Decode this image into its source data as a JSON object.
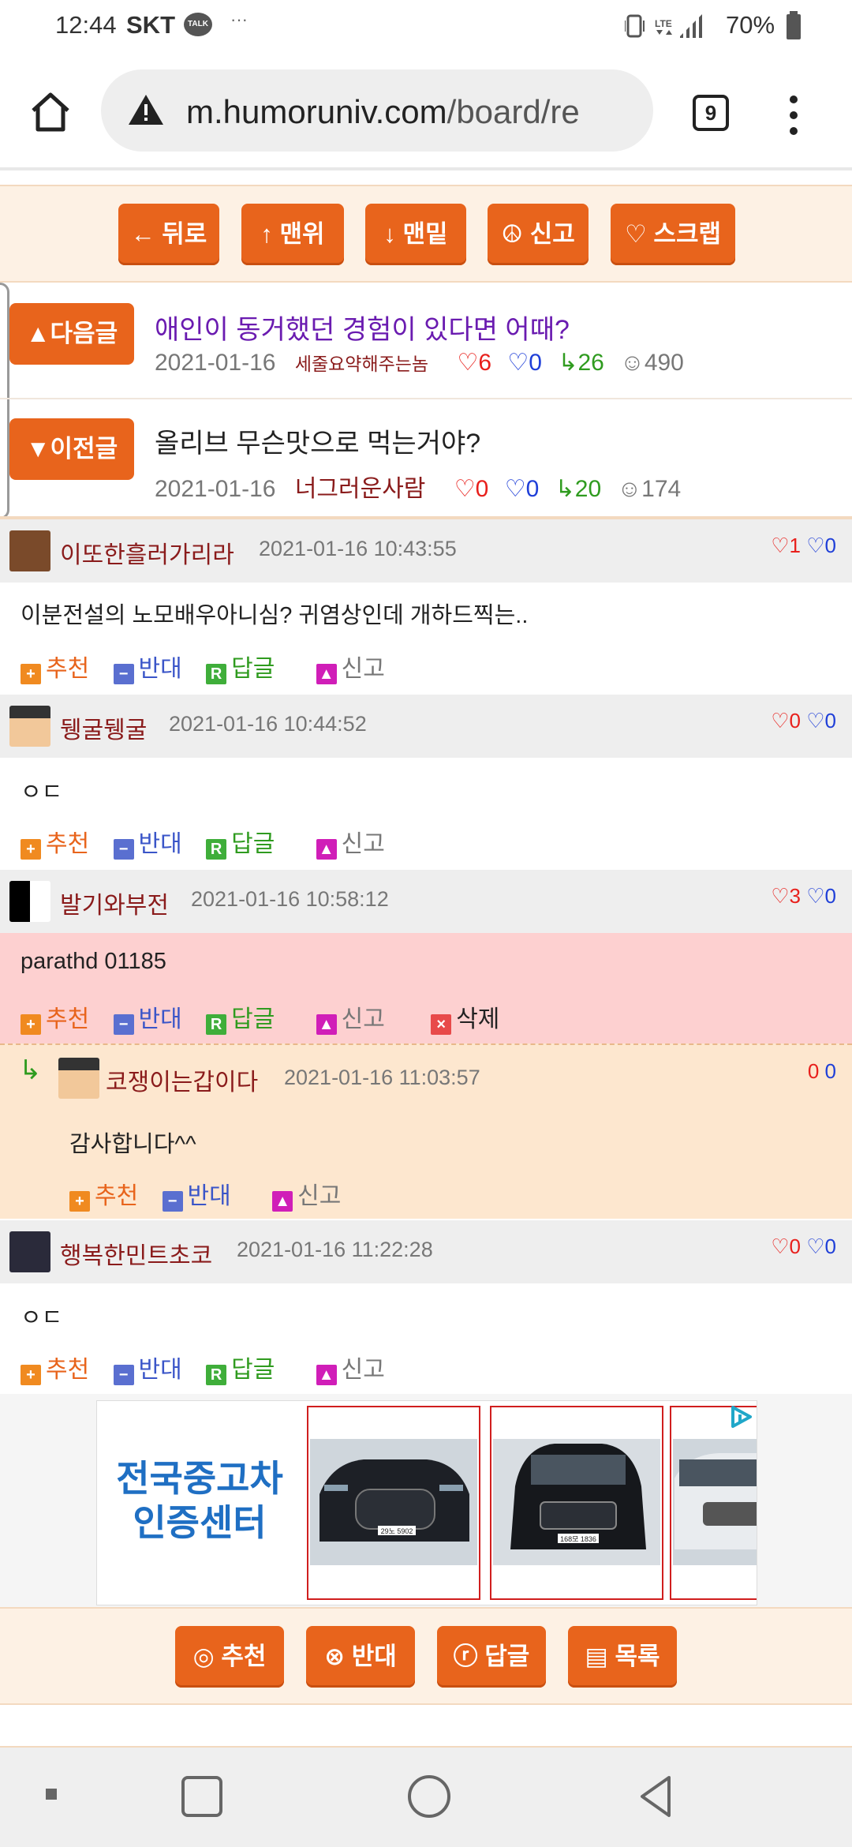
{
  "status_bar": {
    "time": "12:44",
    "carrier": "SKT",
    "talk_badge": "TALK",
    "overflow": "···",
    "battery": "70%"
  },
  "browser": {
    "url_host": "m.humoruniv.com",
    "url_path": "/board/re",
    "tab_count": "9"
  },
  "nav_buttons": [
    {
      "label": "← 뒤로"
    },
    {
      "label": "↑ 맨위"
    },
    {
      "label": "↓ 맨밑"
    },
    {
      "label": "신고"
    },
    {
      "label": "스크랩"
    }
  ],
  "next_post": {
    "button": "▲다음글",
    "title": "애인이 동거했던 경험이 있다면 어때?",
    "date": "2021-01-16",
    "author": "세줄요약해주는놈",
    "up": "6",
    "down": "0",
    "replies": "26",
    "views": "490"
  },
  "prev_post": {
    "button": "▼이전글",
    "title": "올리브 무슨맛으로 먹는거야?",
    "date": "2021-01-16",
    "author": "너그러운사람",
    "up": "0",
    "down": "0",
    "replies": "20",
    "views": "174"
  },
  "actions": {
    "recommend": "추천",
    "oppose": "반대",
    "reply": "답글",
    "report": "신고",
    "delete": "삭제"
  },
  "comments": [
    {
      "name": "이또한흘러가리라",
      "date": "2021-01-16 10:43:55",
      "up": "1",
      "down": "0",
      "body": "이분전설의 노모배우아니심? 귀염상인데 개하드찍는.."
    },
    {
      "name": "뒝굴뒝굴",
      "date": "2021-01-16 10:44:52",
      "up": "0",
      "down": "0",
      "body": "ㅇㄷ"
    },
    {
      "name": "발기와부전",
      "date": "2021-01-16 10:58:12",
      "up": "3",
      "down": "0",
      "body": "parathd 01185"
    },
    {
      "name": "코쟁이는갑이다",
      "date": "2021-01-16 11:03:57",
      "up": "0",
      "down": "0",
      "body": "감사합니다^^"
    },
    {
      "name": "행복한민트초코",
      "date": "2021-01-16 11:22:28",
      "up": "0",
      "down": "0",
      "body": "ㅇㄷ"
    }
  ],
  "ad": {
    "logo_line1": "전국중고차",
    "logo_line2": "인증센터",
    "plate1": "29노 5902",
    "plate2": "168모 1836"
  },
  "bottom_buttons": [
    {
      "label": "추천"
    },
    {
      "label": "반대"
    },
    {
      "label": "답글"
    },
    {
      "label": "목록"
    }
  ]
}
